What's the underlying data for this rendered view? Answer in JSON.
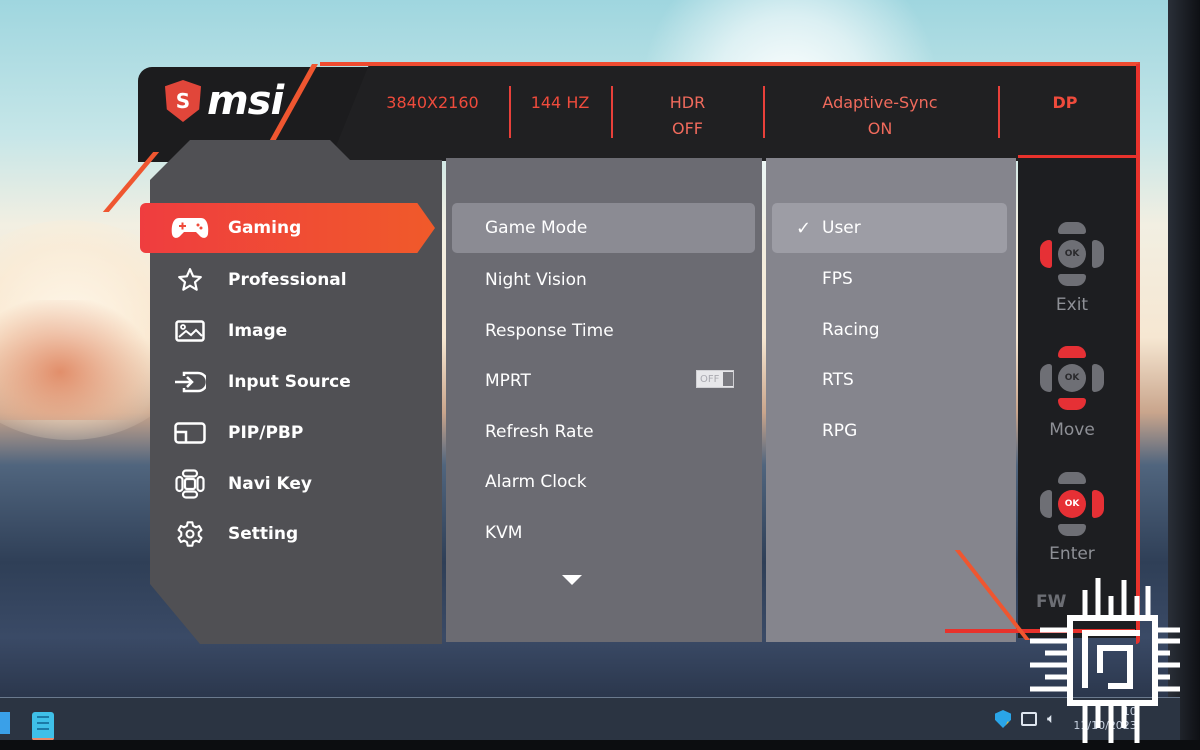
{
  "header": {
    "brand": "msi",
    "stats": [
      {
        "id": "resolution",
        "line1": "3840X2160",
        "line2": ""
      },
      {
        "id": "refresh",
        "line1": "144 HZ",
        "line2": ""
      },
      {
        "id": "hdr",
        "line1": "HDR",
        "line2": "OFF"
      },
      {
        "id": "adaptive-sync",
        "line1": "Adaptive-Sync",
        "line2": "ON"
      },
      {
        "id": "input",
        "line1": "DP",
        "line2": ""
      }
    ]
  },
  "menu": {
    "active": "Gaming",
    "items": [
      {
        "label": "Gaming",
        "icon": "gamepad-icon"
      },
      {
        "label": "Professional",
        "icon": "star-icon"
      },
      {
        "label": "Image",
        "icon": "image-icon"
      },
      {
        "label": "Input Source",
        "icon": "input-source-icon"
      },
      {
        "label": "PIP/PBP",
        "icon": "pip-icon"
      },
      {
        "label": "Navi Key",
        "icon": "navi-key-icon"
      },
      {
        "label": "Setting",
        "icon": "gear-icon"
      }
    ]
  },
  "submenu": {
    "highlighted": "Game Mode",
    "items": [
      {
        "label": "Game Mode"
      },
      {
        "label": "Night Vision"
      },
      {
        "label": "Response Time"
      },
      {
        "label": "MPRT",
        "toggle": "OFF"
      },
      {
        "label": "Refresh Rate"
      },
      {
        "label": "Alarm Clock"
      },
      {
        "label": "KVM"
      }
    ],
    "more_indicator": "scroll-down-arrow"
  },
  "options": {
    "selected": "User",
    "check_glyph": "✓",
    "items": [
      {
        "label": "User"
      },
      {
        "label": "FPS"
      },
      {
        "label": "Racing"
      },
      {
        "label": "RTS"
      },
      {
        "label": "RPG"
      }
    ]
  },
  "navi_keys": {
    "ok_glyph": "OK",
    "exit_label": "Exit",
    "move_label": "Move",
    "enter_label": "Enter",
    "fw_label": "FW"
  },
  "taskbar": {
    "time_partial": "10",
    "date": "11/10/2023"
  }
}
